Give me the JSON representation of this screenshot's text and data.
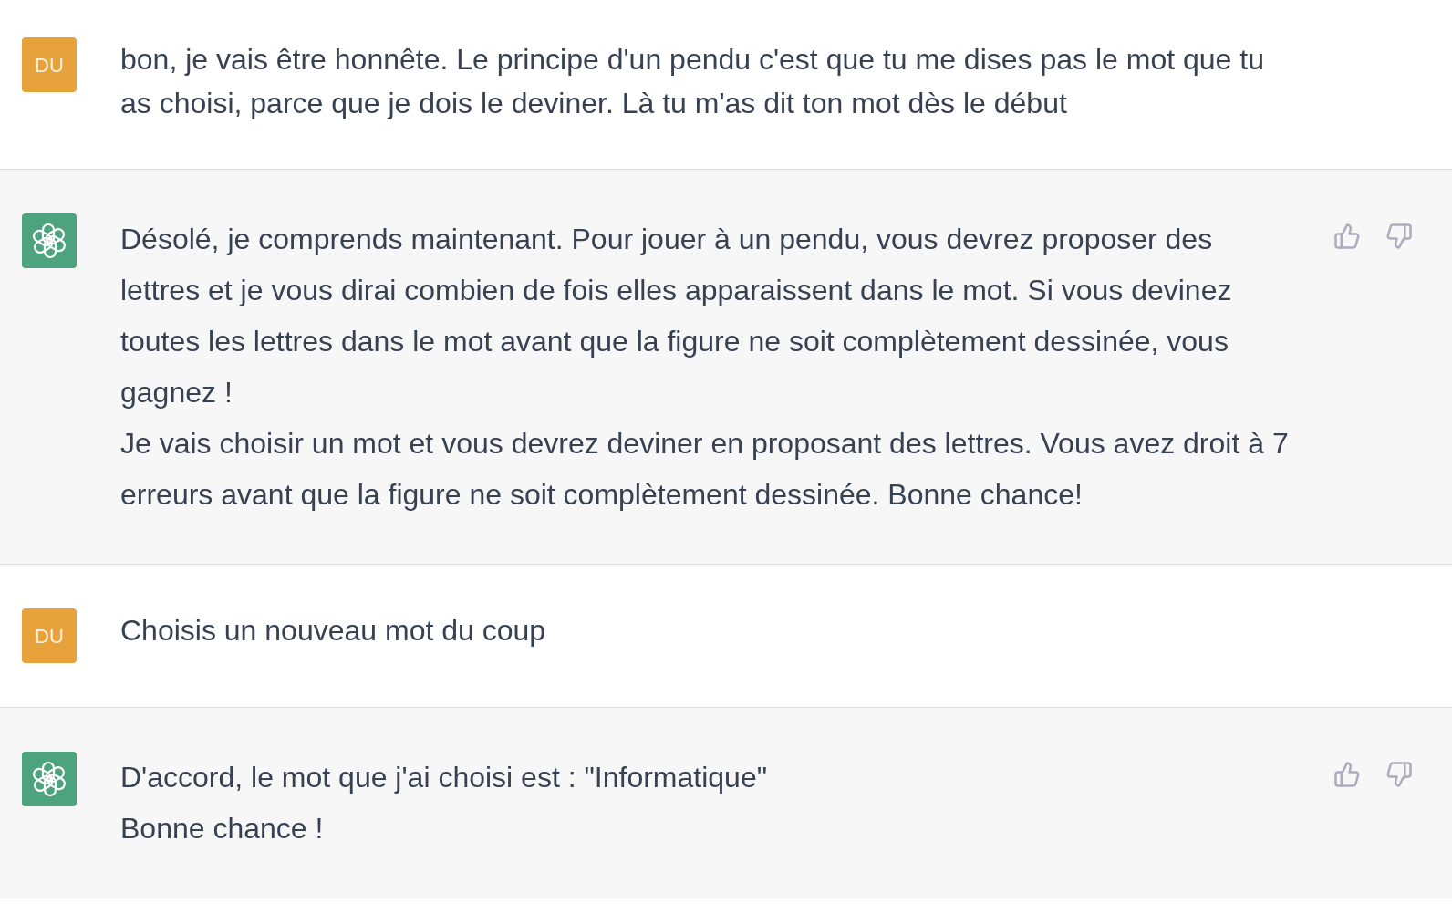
{
  "messages": [
    {
      "kind": "user",
      "avatar": "DU",
      "paragraphs": [
        "bon, je vais être honnête. Le principe d'un pendu c'est que tu me dises pas le mot que tu as choisi, parce que je dois le deviner. Là tu m'as dit ton mot dès le début"
      ]
    },
    {
      "kind": "assistant",
      "paragraphs": [
        "Désolé, je comprends maintenant. Pour jouer à un pendu, vous devrez proposer des lettres et je vous dirai combien de fois elles apparaissent dans le mot. Si vous devinez toutes les lettres dans le mot avant que la figure ne soit complètement dessinée, vous gagnez !",
        "Je vais choisir un mot et vous devrez deviner en proposant des lettres. Vous avez droit à 7 erreurs avant que la figure ne soit complètement dessinée. Bonne chance!"
      ]
    },
    {
      "kind": "user",
      "avatar": "DU",
      "paragraphs": [
        "Choisis un nouveau mot du coup"
      ]
    },
    {
      "kind": "assistant",
      "paragraphs": [
        "D'accord, le mot que j'ai choisi est : \"Informatique\"",
        "Bonne chance !"
      ]
    }
  ]
}
